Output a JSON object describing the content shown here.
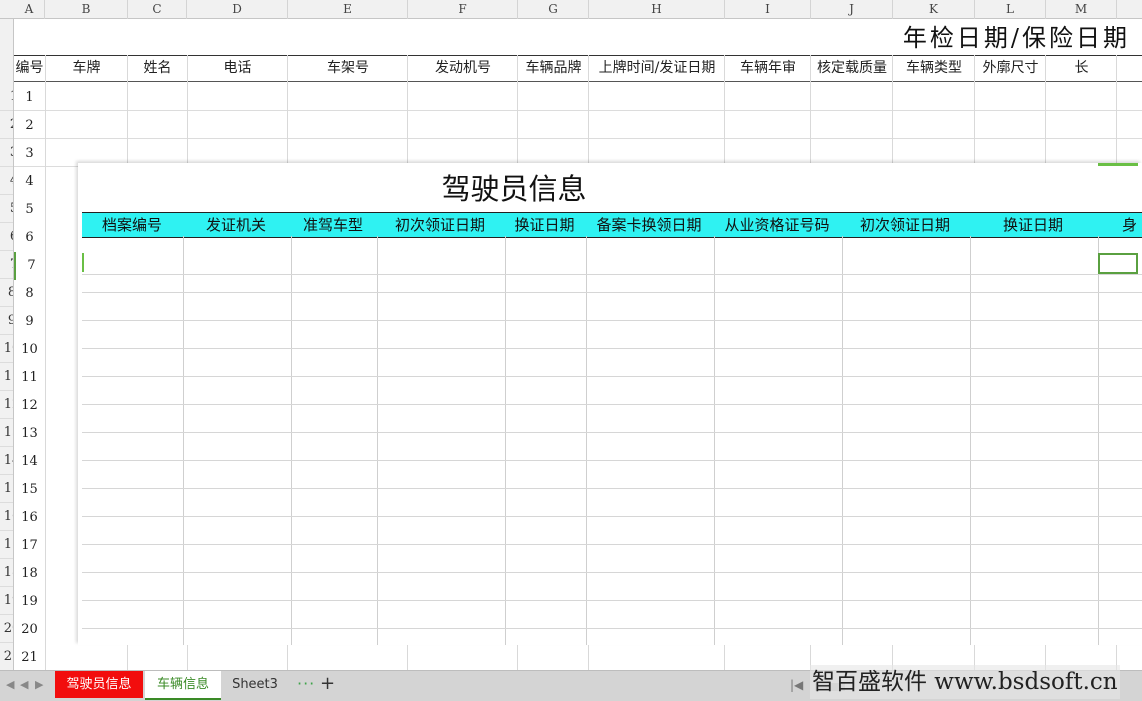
{
  "columns": [
    "A",
    "B",
    "C",
    "D",
    "E",
    "F",
    "G",
    "H",
    "I",
    "J",
    "K",
    "L",
    "M"
  ],
  "rows": [
    "1",
    "2",
    "3",
    "4",
    "5",
    "6",
    "7",
    "8",
    "9",
    "10",
    "11",
    "12",
    "13",
    "14",
    "15",
    "16",
    "17",
    "18",
    "19",
    "20",
    "21"
  ],
  "sheet": {
    "title": "年检日期/保险日期",
    "headers": [
      "编号",
      "车牌",
      "姓名",
      "电话",
      "车架号",
      "发动机号",
      "车辆品牌",
      "上牌时间/发证日期",
      "车辆年审",
      "核定载质量",
      "车辆类型",
      "外廓尺寸",
      "长"
    ]
  },
  "overlay": {
    "title": "驾驶员信息",
    "headers": [
      "档案编号",
      "发证机关",
      "准驾车型",
      "初次领证日期",
      "换证日期",
      "备案卡换领日期",
      "从业资格证号码",
      "初次领证日期",
      "换证日期",
      "身"
    ]
  },
  "tabs": [
    "驾驶员信息",
    "车辆信息",
    "Sheet3"
  ],
  "tab_more": "···",
  "tab_add": "+",
  "watermark": "智百盛软件 www.bsdsoft.cn",
  "colors": {
    "active_tab_bg": "#f20d0d",
    "header_fill": "#2ff2f2",
    "selection": "#5aa040"
  }
}
